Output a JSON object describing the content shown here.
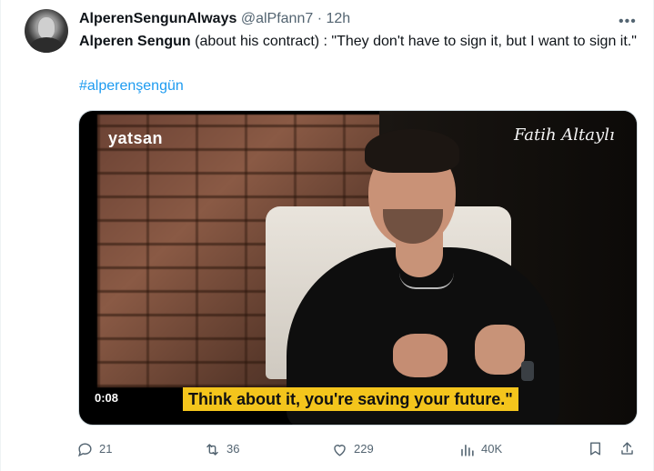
{
  "tweet": {
    "display_name": "AlperenSengunAlways",
    "handle": "@alPfann7",
    "separator": "·",
    "time": "12h",
    "more_label": "•••",
    "text_bold": "Alperen Sengun",
    "text_rest": " (about his contract) : \"They don't have to sign it, but I want to sign it.\"",
    "hashtag": "#alperenşengün"
  },
  "media": {
    "logo": "yatsan",
    "signature": "Fatih Altaylı",
    "subtitle": "Think about it, you're saving your future.\"",
    "duration": "0:08"
  },
  "actions": {
    "replies": "21",
    "retweets": "36",
    "likes": "229",
    "views": "40K"
  },
  "colors": {
    "link": "#1d9bf0",
    "muted": "#536471",
    "subtitle_bg": "#f4c51c"
  },
  "icons": [
    "avatar",
    "more-icon",
    "reply-icon",
    "retweet-icon",
    "like-icon",
    "views-icon",
    "bookmark-icon",
    "share-icon"
  ]
}
